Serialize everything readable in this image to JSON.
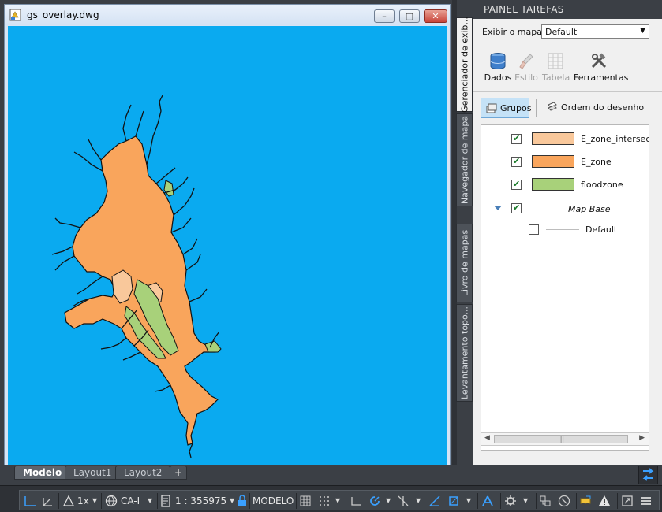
{
  "drawing_window": {
    "title": "gs_overlay.dwg",
    "minimize_icon": "minimize-icon",
    "maximize_icon": "maximize-icon",
    "close_icon": "close-icon",
    "canvas_background": "#0aaaf0"
  },
  "task_pane": {
    "title": "PAINEL TAREFAS",
    "map_label": "Exibir o mapa:",
    "map_value": "Default",
    "tools": [
      {
        "label": "Dados",
        "icon": "database-icon",
        "enabled": true
      },
      {
        "label": "Estilo",
        "icon": "paintbrush-icon",
        "enabled": false
      },
      {
        "label": "Tabela",
        "icon": "table-icon",
        "enabled": false
      },
      {
        "label": "Ferramentas",
        "icon": "tools-icon",
        "enabled": true
      }
    ],
    "view_tabs": [
      {
        "label": "Grupos",
        "icon": "groups-icon",
        "active": true
      },
      {
        "label": "Ordem do desenho",
        "icon": "draw-order-icon",
        "active": false
      }
    ],
    "layers": [
      {
        "name": "E_zone_intersec",
        "checked": true,
        "color": "#f9c89b"
      },
      {
        "name": "E_zone",
        "checked": true,
        "color": "#f9a55c"
      },
      {
        "name": "floodzone",
        "checked": true,
        "color": "#a8d17a"
      }
    ],
    "group": {
      "name": "Map Base",
      "checked": true,
      "expanded": true
    },
    "base_item": {
      "name": "Default",
      "checked": false
    }
  },
  "side_tabs": [
    "Gerenciador de exib...",
    "Navegador de mapa",
    "Livro de mapas",
    "Levantamento topo..."
  ],
  "layout_tabs": [
    "Modelo",
    "Layout1",
    "Layout2"
  ],
  "layout_add": "+",
  "status_bar": {
    "scale_factor": "1x",
    "coord_system": "CA-I",
    "map_scale": "1 : 355975",
    "space": "MODELO"
  },
  "colors": {
    "e_zone": "#f9a55c",
    "e_zone_intersec": "#f9c89b",
    "floodzone": "#a8d17a",
    "pane_dark": "#3b3f45",
    "selection": "#c5e2f7"
  }
}
